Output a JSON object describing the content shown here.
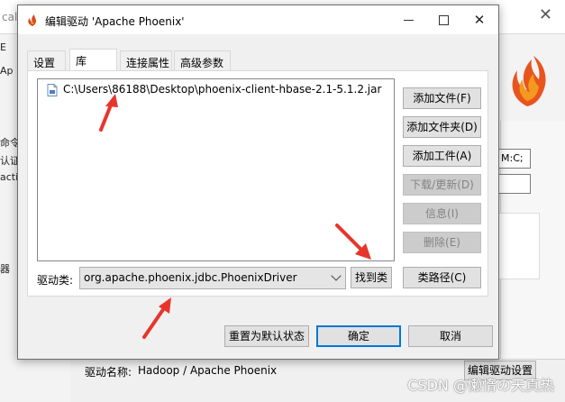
{
  "background": {
    "topbar_text": "cal",
    "left_labels": [
      "E",
      "Ap",
      "命令",
      "认证",
      "acti",
      "器"
    ],
    "field_text": "M:C;",
    "driver_name_label": "驱动名称:",
    "driver_name_value": "Hadoop / Apache Phoenix",
    "edit_driver_button": "编辑驱动设置",
    "close_icon": "close-icon",
    "watermark": "CSDN @懒惰の天真热"
  },
  "dialog": {
    "title": "编辑驱动 'Apache Phoenix'",
    "title_icon": "flame-icon",
    "tabs": [
      {
        "label": "设置",
        "active": false
      },
      {
        "label": "库",
        "active": true
      },
      {
        "label": "连接属性",
        "active": false
      },
      {
        "label": "高级参数",
        "active": false
      }
    ],
    "library": {
      "items": [
        {
          "icon": "jar-file-icon",
          "path": "C:\\Users\\86188\\Desktop\\phoenix-client-hbase-2.1-5.1.2.jar"
        }
      ],
      "buttons": {
        "add_file": {
          "label": "添加文件(F)",
          "enabled": true
        },
        "add_folder": {
          "label": "添加文件夹(D)",
          "enabled": true
        },
        "add_artifact": {
          "label": "添加工件(A)",
          "enabled": true
        },
        "download_update": {
          "label": "下载/更新(D)",
          "enabled": false
        },
        "info": {
          "label": "信息(I)",
          "enabled": false
        },
        "delete": {
          "label": "删除(E)",
          "enabled": false
        },
        "classpath": {
          "label": "类路径(C)",
          "enabled": true
        }
      },
      "driver_class_label": "驱动类:",
      "driver_class_value": "org.apache.phoenix.jdbc.PhoenixDriver",
      "find_class_button": "找到类"
    },
    "footer": {
      "reset_button": "重置为默认状态",
      "ok_button": "确定",
      "cancel_button": "取消"
    }
  },
  "colors": {
    "annotation_arrow": "#e8352b",
    "dialog_bg": "#f0f0f0",
    "button_bg": "#e1e1e1",
    "disabled_button_bg": "#cccccc"
  }
}
